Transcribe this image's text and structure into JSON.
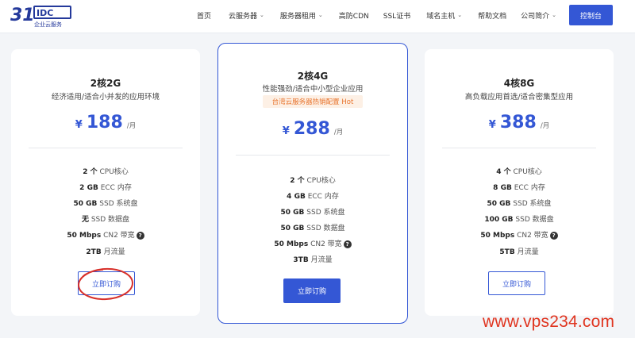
{
  "header": {
    "logo_text": "31IDC",
    "logo_sub": "企业云服务",
    "nav": [
      {
        "label": "首页",
        "has_dropdown": false
      },
      {
        "label": "云服务器",
        "has_dropdown": true
      },
      {
        "label": "服务器租用",
        "has_dropdown": true
      },
      {
        "label": "高防CDN",
        "has_dropdown": false
      },
      {
        "label": "SSL证书",
        "has_dropdown": false
      },
      {
        "label": "域名主机",
        "has_dropdown": true
      },
      {
        "label": "帮助文档",
        "has_dropdown": false
      },
      {
        "label": "公司简介",
        "has_dropdown": true
      }
    ],
    "console_label": "控制台"
  },
  "plans": [
    {
      "title": "2核2G",
      "subtitle": "经济适用/适合小并发的应用环境",
      "badge": "",
      "currency": "¥",
      "price": "188",
      "per": "/月",
      "specs": [
        {
          "value": "2 个",
          "label": "CPU核心",
          "help": false
        },
        {
          "value": "2 GB",
          "label": "ECC 内存",
          "help": false
        },
        {
          "value": "50 GB",
          "label": "SSD 系统盘",
          "help": false
        },
        {
          "value": "无",
          "label": "SSD 数据盘",
          "help": false
        },
        {
          "value": "50 Mbps",
          "label": "CN2 带宽",
          "help": true
        },
        {
          "value": "2TB",
          "label": "月流量",
          "help": false
        }
      ],
      "button": "立即订购"
    },
    {
      "title": "2核4G",
      "subtitle": "性能强劲/适合中小型企业应用",
      "badge": "台湾云服务器热销配置 Hot",
      "currency": "¥",
      "price": "288",
      "per": "/月",
      "specs": [
        {
          "value": "2 个",
          "label": "CPU核心",
          "help": false
        },
        {
          "value": "4 GB",
          "label": "ECC 内存",
          "help": false
        },
        {
          "value": "50 GB",
          "label": "SSD 系统盘",
          "help": false
        },
        {
          "value": "50 GB",
          "label": "SSD 数据盘",
          "help": false
        },
        {
          "value": "50 Mbps",
          "label": "CN2 带宽",
          "help": true
        },
        {
          "value": "3TB",
          "label": "月流量",
          "help": false
        }
      ],
      "button": "立即订购"
    },
    {
      "title": "4核8G",
      "subtitle": "高负载应用首选/适合密集型应用",
      "badge": "",
      "currency": "¥",
      "price": "388",
      "per": "/月",
      "specs": [
        {
          "value": "4 个",
          "label": "CPU核心",
          "help": false
        },
        {
          "value": "8 GB",
          "label": "ECC 内存",
          "help": false
        },
        {
          "value": "50 GB",
          "label": "SSD 系统盘",
          "help": false
        },
        {
          "value": "100 GB",
          "label": "SSD 数据盘",
          "help": false
        },
        {
          "value": "50 Mbps",
          "label": "CN2 带宽",
          "help": true
        },
        {
          "value": "5TB",
          "label": "月流量",
          "help": false
        }
      ],
      "button": "立即订购"
    }
  ],
  "help_glyph": "?",
  "chevron_glyph": "⌄",
  "watermark": "www.vps234.com",
  "colors": {
    "accent": "#3457d5",
    "hot": "#e8732c",
    "annotation": "#d8302a",
    "watermark": "#e0341f"
  }
}
